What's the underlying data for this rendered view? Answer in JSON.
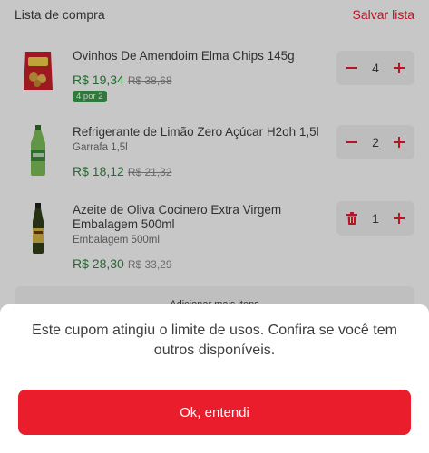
{
  "header": {
    "title": "Lista de compra",
    "save_label": "Salvar lista"
  },
  "items": [
    {
      "name": "Ovinhos De Amendoim Elma Chips 145g",
      "subtitle": "",
      "price": "R$ 19,34",
      "old_price": "R$ 38,68",
      "badge": "4 por 2",
      "quantity": "4",
      "left_action": "minus-icon"
    },
    {
      "name": "Refrigerante de Limão Zero Açúcar H2oh 1,5l",
      "subtitle": "Garrafa 1,5l",
      "price": "R$ 18,12",
      "old_price": "R$ 21,32",
      "badge": "",
      "quantity": "2",
      "left_action": "minus-icon"
    },
    {
      "name": "Azeite de Oliva Cocinero Extra Virgem Embalagem 500ml",
      "subtitle": "Embalagem 500ml",
      "price": "R$ 28,30",
      "old_price": "R$ 33,29",
      "badge": "",
      "quantity": "1",
      "left_action": "trash-icon"
    }
  ],
  "add_more_label": "Adicionar mais itens",
  "modal": {
    "message": "Este cupom atingiu o limite de usos. Confira se você tem outros disponíveis.",
    "button_label": "Ok, entendi"
  },
  "colors": {
    "accent": "#ea1d2c",
    "price_green": "#2e8b3e",
    "badge_green": "#3a9d4c"
  }
}
